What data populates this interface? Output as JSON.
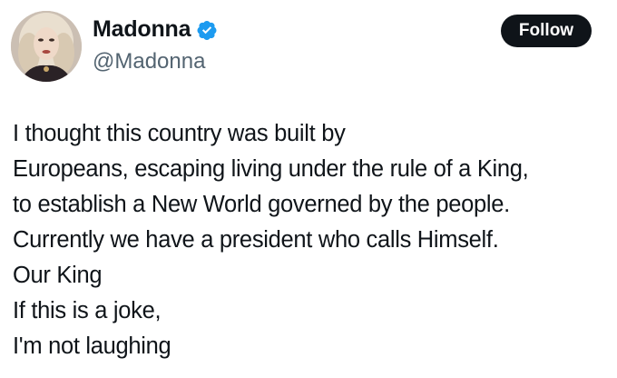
{
  "author": {
    "display_name": "Madonna",
    "handle": "@Madonna",
    "verified": true,
    "verified_color": "#1d9bf0"
  },
  "follow_button": {
    "label": "Follow",
    "background": "#0f1419",
    "text_color": "#ffffff"
  },
  "tweet": {
    "lines": [
      "I thought this country was built by",
      "Europeans, escaping living under the rule of a King,",
      "to establish a New World governed by the people.",
      "Currently we have a president who calls Himself.",
      "Our King",
      "If this is a joke,",
      "I'm not laughing"
    ]
  },
  "icons": {
    "avatar": "profile-photo",
    "verified": "verified-badge-icon"
  }
}
